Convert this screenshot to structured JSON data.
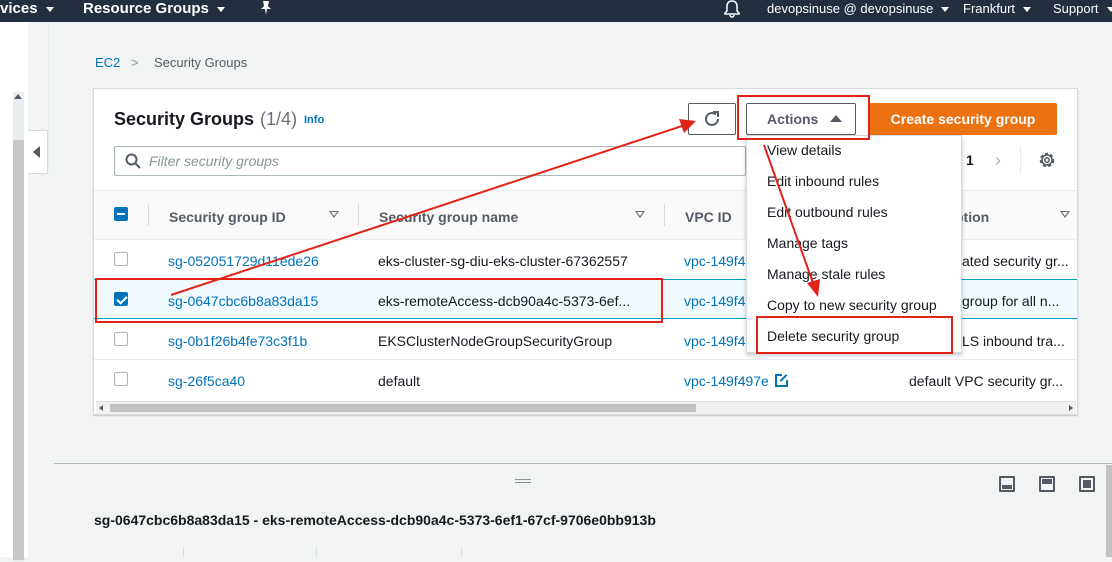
{
  "topnav": {
    "services_label": "vices",
    "resource_groups_label": "Resource Groups",
    "account_label": "devopsinuse @ devopsinuse",
    "region_label": "Frankfurt",
    "support_label": "Support"
  },
  "breadcrumb": {
    "root": "EC2",
    "separator": ">",
    "current": "Security Groups"
  },
  "header": {
    "title": "Security Groups",
    "count": "(1/4)",
    "info_label": "Info",
    "actions_label": "Actions",
    "create_label": "Create security group"
  },
  "filter": {
    "placeholder": "Filter security groups"
  },
  "pagination": {
    "page": "1",
    "next": "›"
  },
  "table": {
    "columns": {
      "id": "Security group ID",
      "name": "Security group name",
      "vpc": "VPC ID",
      "desc": "ption"
    },
    "rows": [
      {
        "id": "sg-052051729d11ede26",
        "name": "eks-cluster-sg-diu-eks-cluster-67362557",
        "vpc": "vpc-149f4",
        "desc": "ated security gr...",
        "selected": false
      },
      {
        "id": "sg-0647cbc6b8a83da15",
        "name": "eks-remoteAccess-dcb90a4c-5373-6ef...",
        "vpc": "vpc-149f4",
        "desc": "group for all n...",
        "selected": true
      },
      {
        "id": "sg-0b1f26b4fe73c3f1b",
        "name": "EKSClusterNodeGroupSecurityGroup",
        "vpc": "vpc-149f4",
        "desc": "LS inbound tra...",
        "selected": false
      },
      {
        "id": "sg-26f5ca40",
        "name": "default",
        "vpc": "vpc-149f497e",
        "desc": "default VPC security gr...",
        "selected": false
      }
    ]
  },
  "actions_menu": [
    "View details",
    "Edit inbound rules",
    "Edit outbound rules",
    "Manage tags",
    "Manage stale rules",
    "Copy to new security group",
    "Delete security group"
  ],
  "detail": {
    "title": "sg-0647cbc6b8a83da15 - eks-remoteAccess-dcb90a4c-5373-6ef1-67cf-9706e0bb913b"
  },
  "colors": {
    "nav_bg": "#232f3e",
    "link": "#0073bb",
    "primary_button": "#ec7211",
    "annotation_red": "#e2231a"
  },
  "icons": [
    "bell-icon",
    "pin-icon",
    "refresh-icon",
    "search-icon",
    "settings-gear-icon",
    "external-link-icon",
    "caret-up-icon",
    "chevron-right-icon"
  ]
}
